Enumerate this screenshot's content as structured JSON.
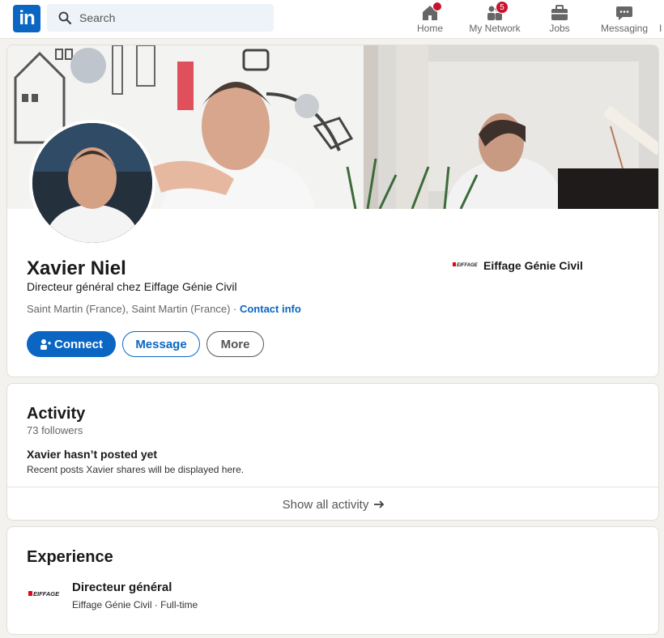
{
  "nav": {
    "logo": "in",
    "search_placeholder": "Search",
    "items": [
      {
        "label": "Home",
        "badge": ""
      },
      {
        "label": "My Network",
        "badge": "5"
      },
      {
        "label": "Jobs",
        "badge": ""
      },
      {
        "label": "Messaging",
        "badge": ""
      }
    ],
    "overflow_glyph": "I"
  },
  "profile": {
    "name": "Xavier Niel",
    "headline": "Directeur général chez Eiffage Génie Civil",
    "location": "Saint Martin (France), Saint Martin (France) · ",
    "contact_info": "Contact info",
    "company": "Eiffage Génie Civil",
    "company_logo_text": "EIFFAGE",
    "buttons": {
      "connect": "Connect",
      "message": "Message",
      "more": "More"
    }
  },
  "activity": {
    "title": "Activity",
    "followers": "73 followers",
    "empty_title": "Xavier hasn’t posted yet",
    "empty_sub": "Recent posts Xavier shares will be displayed here.",
    "show_all": "Show all activity"
  },
  "experience": {
    "title": "Experience",
    "role": "Directeur général",
    "company_line": "Eiffage Génie Civil · Full-time",
    "logo_text": "EIFFAGE"
  },
  "colors": {
    "brand": "#0a66c2",
    "badge": "#cb112d",
    "background": "#f4f2ee"
  }
}
